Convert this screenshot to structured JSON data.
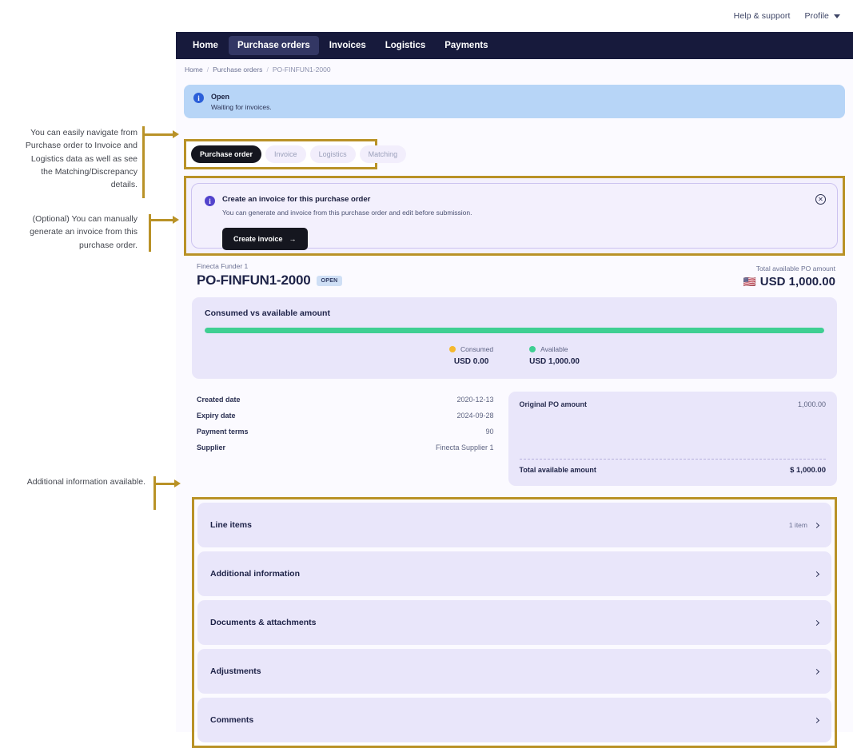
{
  "topbar": {
    "help_label": "Help & support",
    "profile_label": "Profile",
    "chevron_icon": "chevron-down-icon"
  },
  "nav": {
    "items": [
      {
        "label": "Home",
        "active": false
      },
      {
        "label": "Purchase orders",
        "active": true
      },
      {
        "label": "Invoices",
        "active": false
      },
      {
        "label": "Logistics",
        "active": false
      },
      {
        "label": "Payments",
        "active": false
      }
    ]
  },
  "breadcrumb": {
    "items": [
      "Home",
      "Purchase orders",
      "PO-FINFUN1-2000"
    ],
    "separator": "/"
  },
  "status_banner": {
    "icon": "info-circle-icon",
    "title": "Open",
    "subtitle": "Waiting for invoices.",
    "bg_color": "#b7d5f7"
  },
  "tabs": [
    {
      "label": "Purchase order",
      "active": true
    },
    {
      "label": "Invoice",
      "active": false
    },
    {
      "label": "Logistics",
      "active": false
    },
    {
      "label": "Matching",
      "active": false
    }
  ],
  "invoice_card": {
    "icon": "info-circle-icon",
    "title": "Create an invoice for this purchase order",
    "subtitle": "You can generate and invoice from this purchase order and edit before submission.",
    "button_label": "Create invoice",
    "button_arrow": "→",
    "close_icon": "close-circle-icon",
    "close_glyph": "✕"
  },
  "po_header": {
    "funder": "Finecta Funder 1",
    "po_number": "PO-FINFUN1-2000",
    "status_badge": "OPEN",
    "right_label": "Total available PO amount",
    "flag_icon": "us-flag-icon",
    "flag_glyph": "🇺🇸",
    "right_amount": "USD 1,000.00"
  },
  "consumed_card": {
    "title": "Consumed vs available amount",
    "bar_fill_percent": 100,
    "legend": [
      {
        "label": "Consumed",
        "value": "USD 0.00",
        "color": "#f5b82e"
      },
      {
        "label": "Available",
        "value": "USD 1,000.00",
        "color": "#3fcf92"
      }
    ]
  },
  "details_left": [
    {
      "label": "Created date",
      "value": "2020-12-13"
    },
    {
      "label": "Expiry date",
      "value": "2024-09-28"
    },
    {
      "label": "Payment terms",
      "value": "90"
    },
    {
      "label": "Supplier",
      "value": "Finecta Supplier 1"
    }
  ],
  "details_right": {
    "rows": [
      {
        "label": "Original PO amount",
        "value": "1,000.00"
      }
    ],
    "total_label": "Total available amount",
    "total_value": "$ 1,000.00"
  },
  "accordions": [
    {
      "title": "Line items",
      "count": "1 item",
      "chevron": "chevron-right-icon"
    },
    {
      "title": "Additional information",
      "count": "",
      "chevron": "chevron-right-icon"
    },
    {
      "title": "Documents & attachments",
      "count": "",
      "chevron": "chevron-right-icon"
    },
    {
      "title": "Adjustments",
      "count": "",
      "chevron": "chevron-right-icon"
    },
    {
      "title": "Comments",
      "count": "",
      "chevron": "chevron-right-icon"
    }
  ],
  "annotations": [
    {
      "text": "You can easily navigate from Purchase order to Invoice and Logistics data as well as see the Matching/Discrepancy details."
    },
    {
      "text": "(Optional) You can manually generate an invoice from this purchase order."
    },
    {
      "text": "Additional information available."
    }
  ],
  "colors": {
    "nav_bg": "#171a3c",
    "accent_gold": "#b99227",
    "card_bg": "#e9e6fa",
    "page_bg": "#fbfaff",
    "dark_button": "#15161f",
    "available_green": "#3fcf92",
    "consumed_amber": "#f5b82e"
  }
}
